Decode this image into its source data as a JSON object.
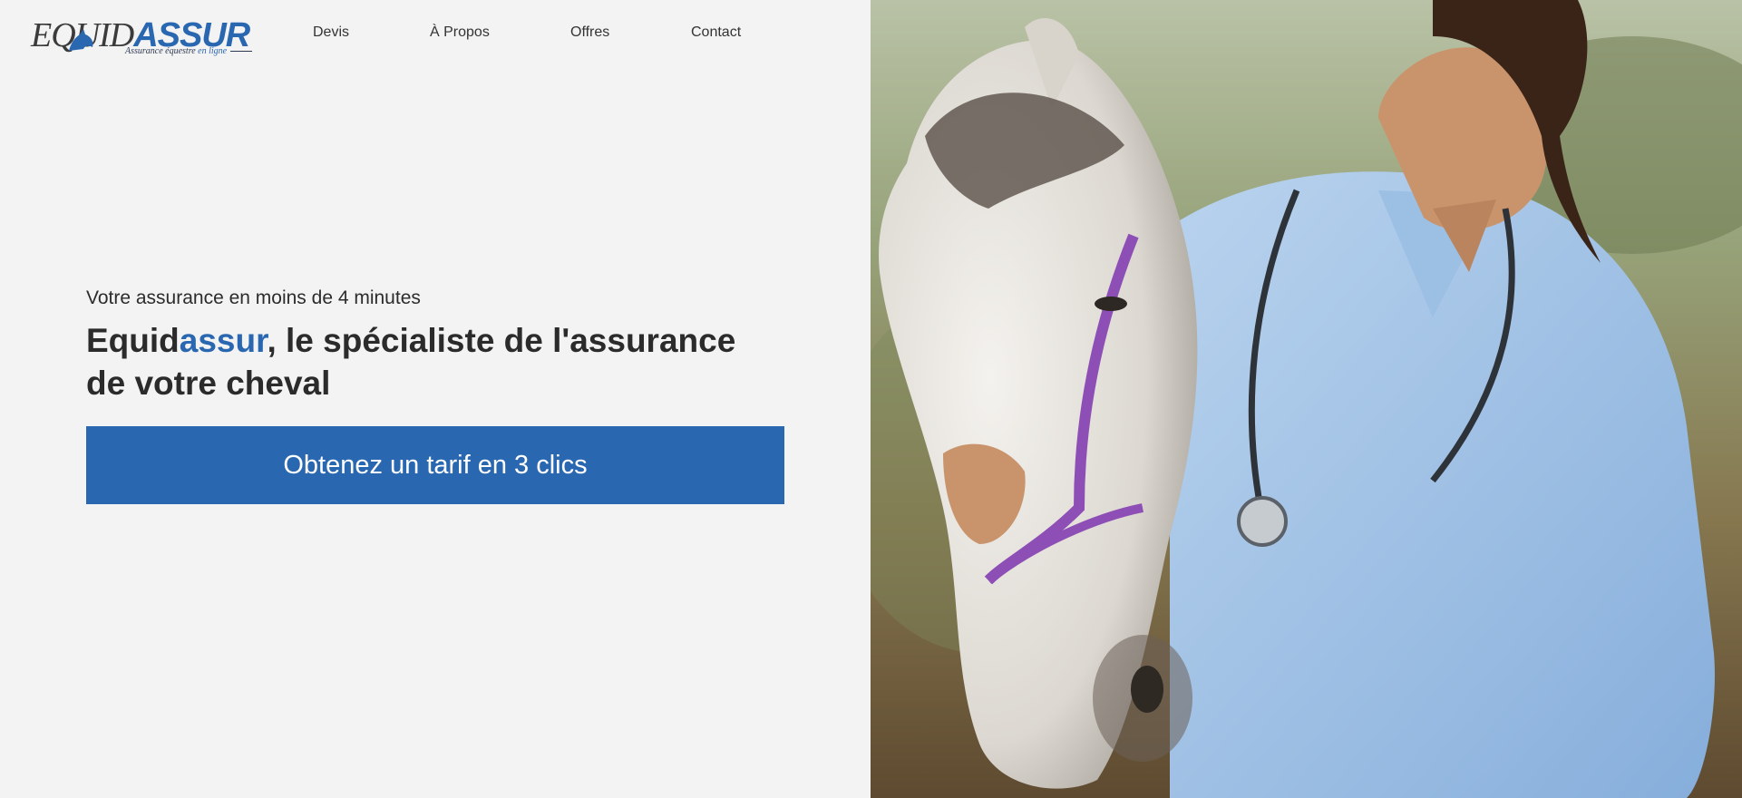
{
  "header": {
    "logo": {
      "word_left": "EQUID",
      "word_right": "ASSUR",
      "tagline_main": "Assurance équestre",
      "tagline_highlight": "en ligne"
    },
    "nav": [
      {
        "label": "Devis"
      },
      {
        "label": "À Propos"
      },
      {
        "label": "Offres"
      },
      {
        "label": "Contact"
      }
    ]
  },
  "hero": {
    "eyebrow": "Votre assurance en moins de 4 minutes",
    "headline_brand_plain": "Equid",
    "headline_brand_accent": "assur",
    "headline_rest": ", le spécialiste de l'assurance de votre cheval",
    "cta_label": "Obtenez un tarif en 3 clics",
    "photo_subject": "veterinarian-with-white-horse"
  },
  "colors": {
    "brand_blue": "#2a67b1",
    "page_background": "#f3f3f3",
    "text_dark": "#2b2b2b"
  }
}
